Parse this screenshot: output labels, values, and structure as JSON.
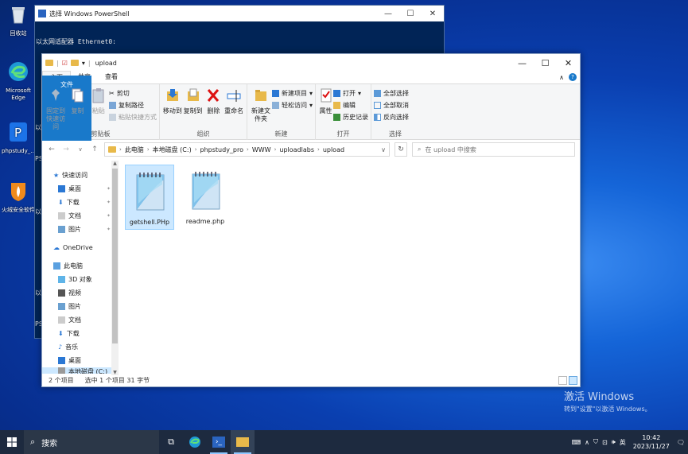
{
  "desktop": {
    "icons": [
      {
        "label": "回收站",
        "icon": "recycle-bin-icon"
      },
      {
        "label": "Microsoft Edge",
        "icon": "edge-icon"
      },
      {
        "label": "phpstudy_...",
        "icon": "phpstudy-icon"
      },
      {
        "label": "火绒安全软件",
        "icon": "huorong-icon"
      }
    ]
  },
  "powershell": {
    "title": "选择 Windows PowerShell",
    "line1": "以太网适配器 Ethernet0:",
    "side_fragments": [
      "PS",
      "以",
      "以",
      "以",
      "PS"
    ]
  },
  "explorer": {
    "title": "upload",
    "tabs": {
      "file": "文件",
      "home": "主页",
      "share": "共享",
      "view": "查看"
    },
    "ribbon": {
      "clipboard": {
        "pin": "固定到快速访问",
        "copy": "复制",
        "paste": "粘贴",
        "cut": "剪切",
        "copy_path": "复制路径",
        "paste_shortcut": "粘贴快捷方式",
        "label": "剪贴板"
      },
      "organize": {
        "move_to": "移动到",
        "copy_to": "复制到",
        "delete": "删除",
        "rename": "重命名",
        "label": "组织"
      },
      "new": {
        "new_folder": "新建文件夹",
        "new_item": "新建项目",
        "easy_access": "轻松访问",
        "label": "新建"
      },
      "open": {
        "properties": "属性",
        "open": "打开",
        "edit": "编辑",
        "history": "历史记录",
        "label": "打开"
      },
      "select": {
        "select_all": "全部选择",
        "select_none": "全部取消",
        "invert": "反向选择",
        "label": "选择"
      }
    },
    "path": [
      "此电脑",
      "本地磁盘 (C:)",
      "phpstudy_pro",
      "WWW",
      "uploadlabs",
      "upload"
    ],
    "search_placeholder": "在 upload 中搜索",
    "nav": {
      "quick_access": "快速访问",
      "desktop": "桌面",
      "downloads": "下载",
      "documents": "文档",
      "pictures": "图片",
      "onedrive": "OneDrive",
      "this_pc": "此电脑",
      "objects3d": "3D 对象",
      "videos": "视频",
      "pictures2": "图片",
      "documents2": "文档",
      "downloads2": "下载",
      "music": "音乐",
      "desktop2": "桌面",
      "local_disk": "本地磁盘 (C:)"
    },
    "files": [
      {
        "name": "getshell.PHp",
        "selected": true
      },
      {
        "name": "readme.php",
        "selected": false
      }
    ],
    "status": {
      "count": "2 个项目",
      "selected": "选中 1 个项目  31 字节"
    }
  },
  "watermark": {
    "line1": "激活 Windows",
    "line2": "转到\"设置\"以激活 Windows。"
  },
  "taskbar": {
    "search_label": "搜索",
    "ime": "英",
    "time": "10:42",
    "date": "2023/11/27"
  },
  "colors": {
    "accent": "#1979ca",
    "selection": "#cce8ff",
    "ps_bg": "#012456"
  }
}
